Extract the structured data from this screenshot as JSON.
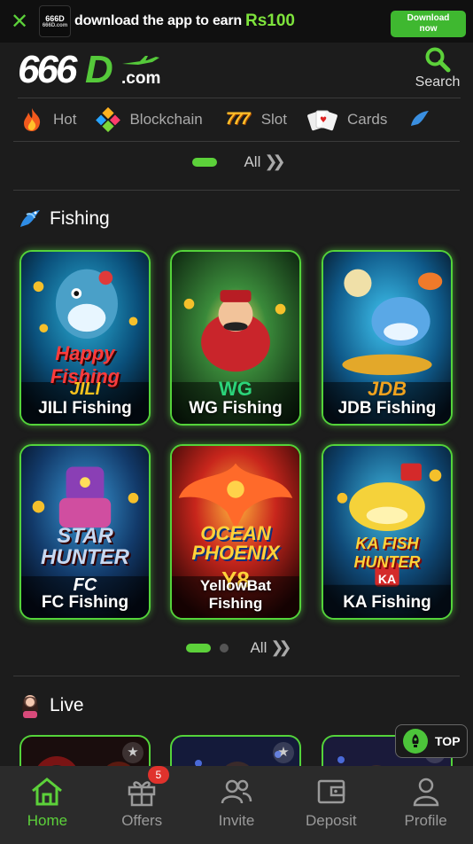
{
  "banner": {
    "close_icon": "close-icon",
    "app_logo_top": "666D",
    "app_logo_bottom": "666D.com",
    "message": "download the app to earn",
    "amount": "Rs100",
    "download_line1": "Download",
    "download_line2": "now",
    "accent_color": "#3fb830"
  },
  "header": {
    "logo_number": "666",
    "logo_letter": "D",
    "logo_suffix": ".com",
    "search_label": "Search"
  },
  "categories": [
    {
      "label": "Hot",
      "icon": "fire-icon"
    },
    {
      "label": "Blockchain",
      "icon": "blockchain-icon"
    },
    {
      "label": "Slot",
      "icon": "slot-777-icon"
    },
    {
      "label": "Cards",
      "icon": "cards-icon"
    }
  ],
  "top_pager": {
    "all_label": "All"
  },
  "fishing": {
    "title": "Fishing",
    "icon": "fish-icon",
    "games": [
      {
        "name": "JILI Fishing",
        "brand": "JILI",
        "headline": "Happy Fishing"
      },
      {
        "name": "WG Fishing",
        "brand": "WG",
        "headline": ""
      },
      {
        "name": "JDB Fishing",
        "brand": "JDB",
        "headline": ""
      },
      {
        "name": "FC Fishing",
        "brand": "FC",
        "headline_line1": "STAR",
        "headline_line2": "HUNTER"
      },
      {
        "name": "YellowBat Fishing",
        "brand": "Y8",
        "headline_line1": "OCEAN",
        "headline_line2": "PHOENIX"
      },
      {
        "name": "KA Fishing",
        "brand": "KA",
        "headline": "KA FISH HUNTER"
      }
    ],
    "pager": {
      "all_label": "All",
      "page": 1,
      "pages": 2
    }
  },
  "live": {
    "title": "Live",
    "icon": "live-dealer-icon"
  },
  "top_button": {
    "label": "TOP"
  },
  "bottom_nav": [
    {
      "label": "Home",
      "icon": "home-icon",
      "active": true
    },
    {
      "label": "Offers",
      "icon": "gift-icon",
      "badge": "5"
    },
    {
      "label": "Invite",
      "icon": "invite-icon"
    },
    {
      "label": "Deposit",
      "icon": "wallet-icon"
    },
    {
      "label": "Profile",
      "icon": "profile-icon"
    }
  ],
  "colors": {
    "accent": "#5cd13a",
    "background": "#1c1c1c",
    "nav_background": "#2b2b2b"
  }
}
